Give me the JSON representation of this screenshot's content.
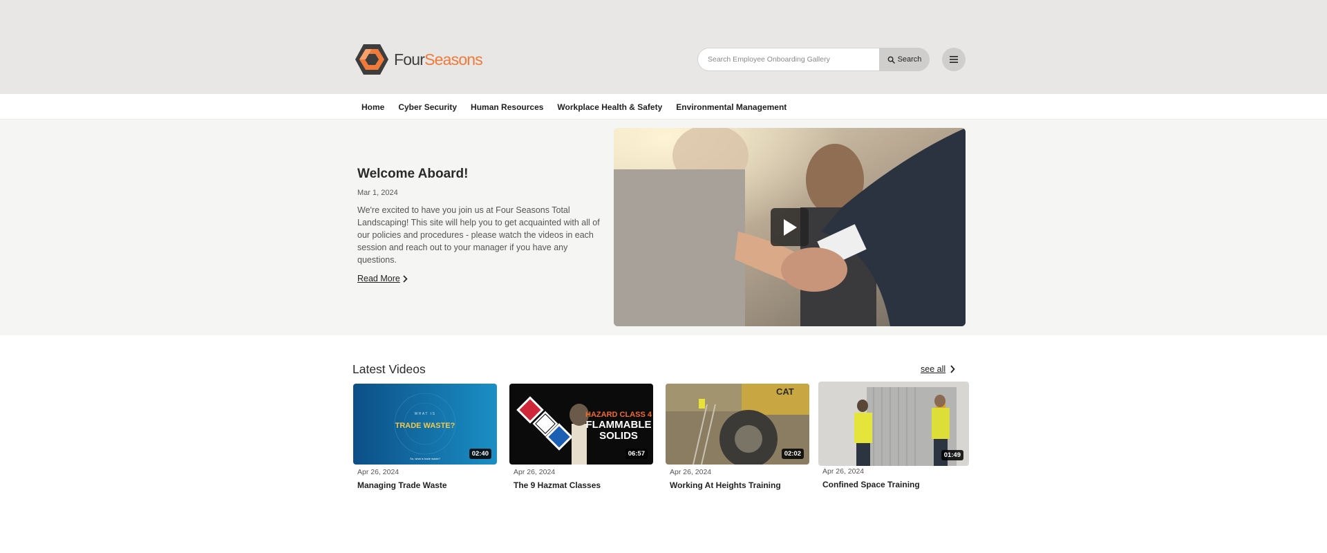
{
  "header": {
    "brand_part1": "Four",
    "brand_part2": "Seasons",
    "search_placeholder": "Search Employee Onboarding Gallery",
    "search_button_label": "Search",
    "accent_color": "#ef7a3a"
  },
  "nav": {
    "items": [
      {
        "label": "Home"
      },
      {
        "label": "Cyber Security"
      },
      {
        "label": "Human Resources"
      },
      {
        "label": "Workplace Health & Safety"
      },
      {
        "label": "Environmental Management"
      }
    ]
  },
  "hero": {
    "title": "Welcome Aboard!",
    "date": "Mar 1, 2024",
    "description": "We're excited to have you join us at Four Seasons Total Landscaping! This site will help you to get acquainted with all of our policies and procedures - please watch the videos in each session and reach out to your manager if you have any questions.",
    "read_more_label": "Read More"
  },
  "latest": {
    "title": "Latest Videos",
    "see_all_label": "see all",
    "videos": [
      {
        "date": "Apr 26, 2024",
        "title": "Managing Trade Waste",
        "duration": "02:40",
        "thumb_text": [
          "WHAT IS",
          "TRADE WASTE?",
          "So, what is trade waste?"
        ]
      },
      {
        "date": "Apr 26, 2024",
        "title": "The 9 Hazmat Classes",
        "duration": "06:57",
        "thumb_text": [
          "HAZARD CLASS 4",
          "FLAMMABLE",
          "SOLIDS"
        ]
      },
      {
        "date": "Apr 26, 2024",
        "title": "Working At Heights Training",
        "duration": "02:02",
        "thumb_text": [
          "CAT"
        ]
      },
      {
        "date": "Apr 26, 2024",
        "title": "Confined Space Training",
        "duration": "01:49",
        "thumb_text": []
      }
    ]
  }
}
